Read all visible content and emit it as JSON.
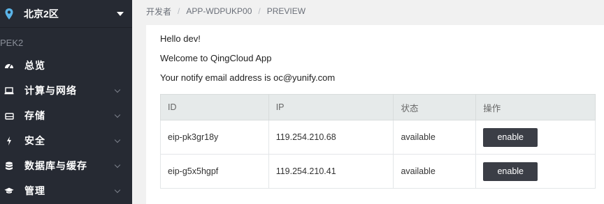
{
  "sidebar": {
    "region": "北京2区",
    "zone": "PEK2",
    "items": [
      {
        "label": "总览",
        "icon": "dashboard-icon",
        "has_arrow": false
      },
      {
        "label": "计算与网络",
        "icon": "laptop-icon",
        "has_arrow": true
      },
      {
        "label": "存储",
        "icon": "hard-drive-icon",
        "has_arrow": true
      },
      {
        "label": "安全",
        "icon": "bolt-icon",
        "has_arrow": true
      },
      {
        "label": "数据库与缓存",
        "icon": "database-icon",
        "has_arrow": true
      },
      {
        "label": "管理",
        "icon": "graduation-cap-icon",
        "has_arrow": true
      }
    ]
  },
  "breadcrumb": [
    "开发者",
    "APP-WDPUKP00",
    "PREVIEW"
  ],
  "content": {
    "greeting": "Hello dev!",
    "welcome": "Welcome to QingCloud App",
    "notify": "Your notify email address is oc@yunify.com"
  },
  "table": {
    "headers": [
      "ID",
      "IP",
      "状态",
      "操作"
    ],
    "rows": [
      {
        "id": "eip-pk3gr18y",
        "ip": "119.254.210.68",
        "status": "available",
        "action": "enable"
      },
      {
        "id": "eip-g5x5hgpf",
        "ip": "119.254.210.41",
        "status": "available",
        "action": "enable"
      }
    ]
  },
  "colors": {
    "sidebar_bg": "#262a33",
    "accent_pin": "#5ab4e8",
    "button_bg": "#3b3e46"
  }
}
